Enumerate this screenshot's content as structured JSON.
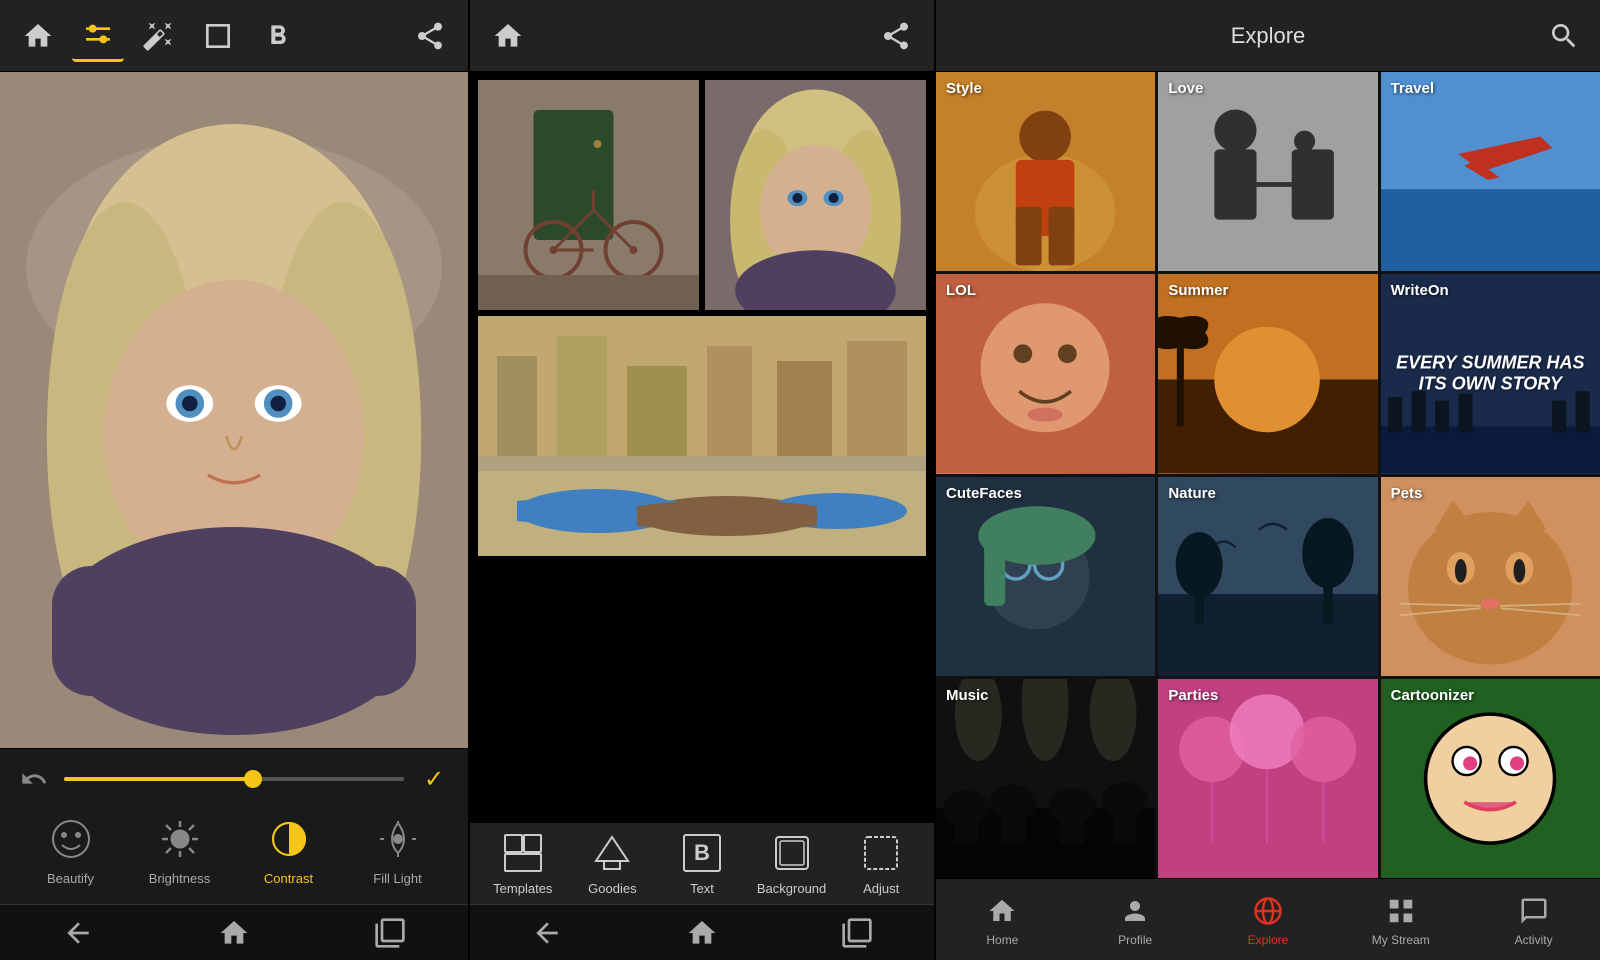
{
  "panel1": {
    "toolbar": {
      "home_label": "Home",
      "adjust_icon": "adjust",
      "wand_icon": "magic-wand",
      "frame_icon": "frame",
      "bold_icon": "bold-b",
      "share_icon": "share"
    },
    "tools": [
      {
        "id": "beautify",
        "label": "Beautify",
        "active": false
      },
      {
        "id": "brightness",
        "label": "Brightness",
        "active": false
      },
      {
        "id": "contrast",
        "label": "Contrast",
        "active": true
      },
      {
        "id": "fill-light",
        "label": "Fill Light",
        "active": false
      },
      {
        "id": "more",
        "label": "...",
        "active": false
      }
    ],
    "slider": {
      "value": 55,
      "percent": "55%"
    }
  },
  "panel2": {
    "toolbar": {
      "home_icon": "home",
      "share_icon": "share"
    },
    "bottom_tools": [
      {
        "id": "templates",
        "label": "Templates"
      },
      {
        "id": "goodies",
        "label": "Goodies"
      },
      {
        "id": "text",
        "label": "Text"
      },
      {
        "id": "background",
        "label": "Background"
      },
      {
        "id": "adjust",
        "label": "Adjust"
      }
    ]
  },
  "panel3": {
    "header": {
      "title": "Explore"
    },
    "categories": [
      {
        "id": "style",
        "label": "Style",
        "bg": "style"
      },
      {
        "id": "love",
        "label": "Love",
        "bg": "love"
      },
      {
        "id": "travel",
        "label": "Travel",
        "bg": "travel"
      },
      {
        "id": "lol",
        "label": "LOL",
        "bg": "lol"
      },
      {
        "id": "summer",
        "label": "Summer",
        "bg": "summer"
      },
      {
        "id": "writeon",
        "label": "WriteOn",
        "bg": "writeon",
        "quote": "EVERY SUMMER HAS ITS OWN STORY"
      },
      {
        "id": "cutefaces",
        "label": "CuteFaces",
        "bg": "cutefaces"
      },
      {
        "id": "nature",
        "label": "Nature",
        "bg": "nature"
      },
      {
        "id": "pets",
        "label": "Pets",
        "bg": "pets"
      },
      {
        "id": "music",
        "label": "Music",
        "bg": "music"
      },
      {
        "id": "parties",
        "label": "Parties",
        "bg": "parties"
      },
      {
        "id": "cartoonizer",
        "label": "Cartoonizer",
        "bg": "cartoonizer"
      }
    ],
    "nav": [
      {
        "id": "home",
        "label": "Home",
        "active": false,
        "icon": "home"
      },
      {
        "id": "profile",
        "label": "Profile",
        "active": false,
        "icon": "person"
      },
      {
        "id": "explore",
        "label": "Explore",
        "active": true,
        "icon": "globe"
      },
      {
        "id": "mystream",
        "label": "My Stream",
        "active": false,
        "icon": "grid"
      },
      {
        "id": "activity",
        "label": "Activity",
        "active": false,
        "icon": "chat"
      }
    ]
  }
}
